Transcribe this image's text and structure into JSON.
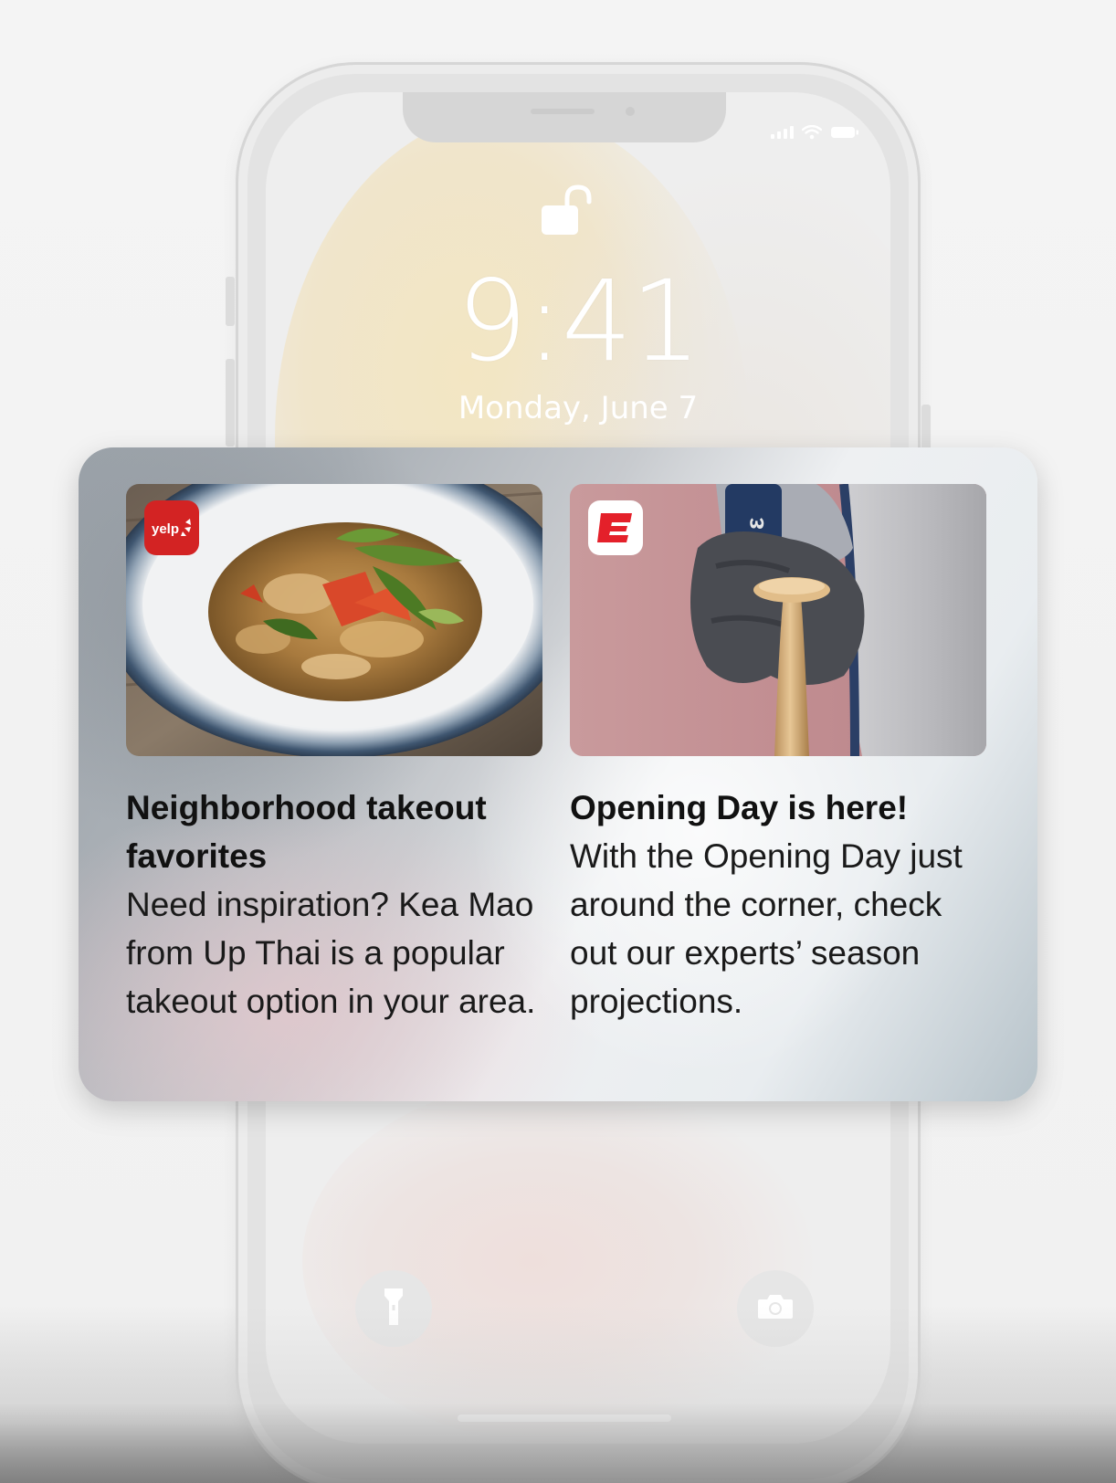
{
  "lock_screen": {
    "time": "9:41",
    "date": "Monday, June 7"
  },
  "status_bar": {
    "signal_icon": "cellular-signal-icon",
    "wifi_icon": "wifi-icon",
    "battery_icon": "battery-icon"
  },
  "quick_actions": {
    "left_icon": "flashlight-icon",
    "right_icon": "camera-icon"
  },
  "notifications": [
    {
      "app_icon": "yelp-app-icon",
      "app_icon_text": "yelp",
      "image": "plate-of-noodles-image",
      "title": "Neighborhood takeout favorites",
      "body": "Need inspiration? Kea Mao from Up Thai is a popular takeout option in your area."
    },
    {
      "app_icon": "espn-app-icon",
      "app_icon_text": "E",
      "image": "baseball-bat-grip-image",
      "title": "Opening Day is here!",
      "body": "With the Opening Day just around the corner, check out our experts’ season projections."
    }
  ],
  "colors": {
    "yelp_red": "#d32323",
    "espn_red": "#e4202a",
    "phone_frame": "#e3e3e3"
  }
}
